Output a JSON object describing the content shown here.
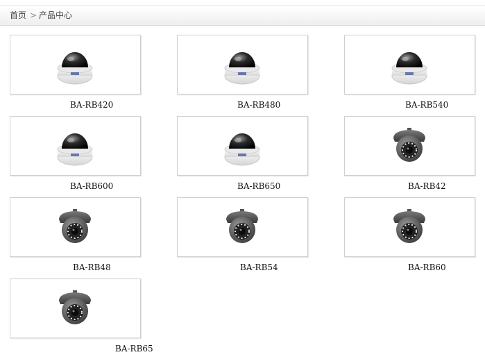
{
  "breadcrumb": {
    "home": "首页",
    "separator": ">",
    "current": "产品中心"
  },
  "products": [
    {
      "model": "BA-RB420",
      "camera": "white-dome"
    },
    {
      "model": "BA-RB480",
      "camera": "white-dome"
    },
    {
      "model": "BA-RB540",
      "camera": "white-dome"
    },
    {
      "model": "BA-RB600",
      "camera": "white-dome"
    },
    {
      "model": "BA-RB650",
      "camera": "white-dome"
    },
    {
      "model": "BA-RB42",
      "camera": "dark-ir-dome"
    },
    {
      "model": "BA-RB48",
      "camera": "dark-ir-dome"
    },
    {
      "model": "BA-RB54",
      "camera": "dark-ir-dome"
    },
    {
      "model": "BA-RB60",
      "camera": "dark-ir-dome"
    },
    {
      "model": "BA-RB65",
      "camera": "dark-ir-dome"
    }
  ]
}
